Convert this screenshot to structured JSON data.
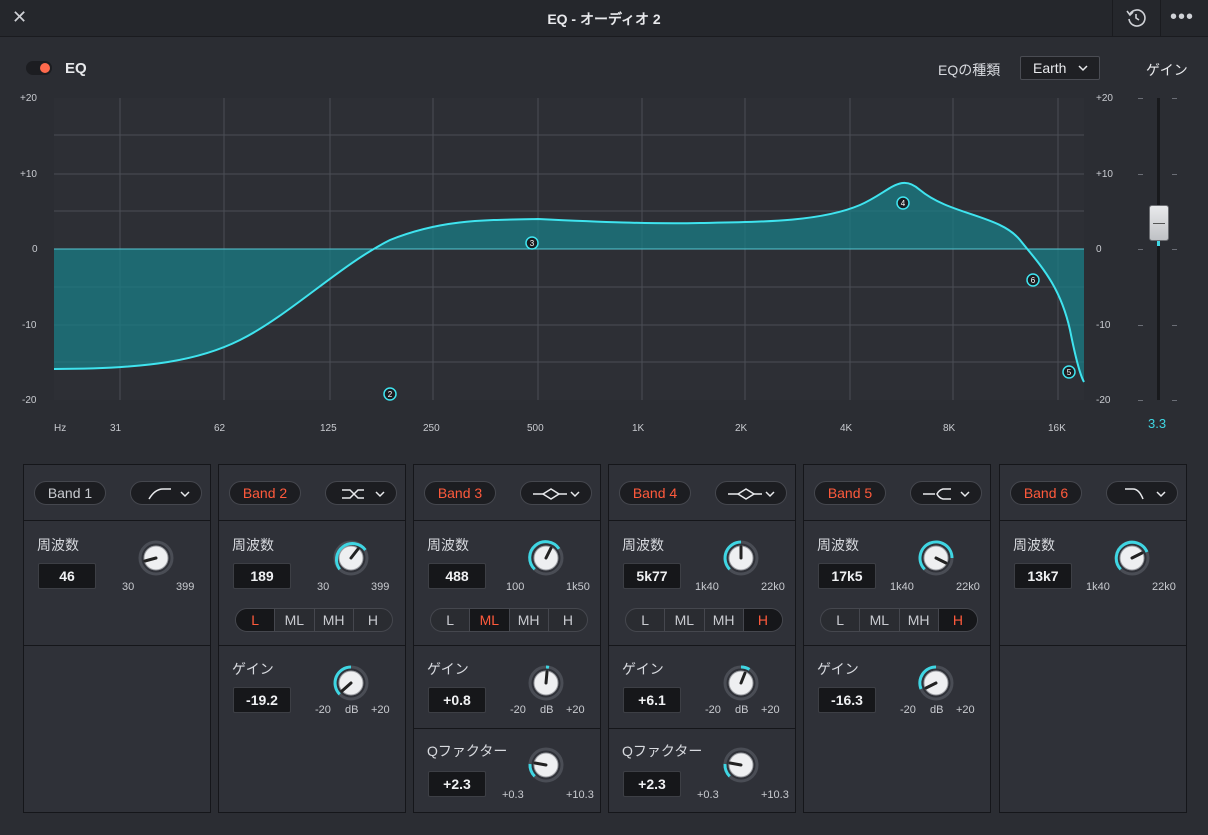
{
  "window": {
    "title": "EQ - オーディオ 2"
  },
  "eq": {
    "label": "EQ",
    "enabled": true,
    "type_label": "EQの種類",
    "type_value": "Earth"
  },
  "gain": {
    "title": "ゲイン",
    "value": "3.3"
  },
  "graph": {
    "ylabels": [
      "+20",
      "+10",
      "0",
      "-10",
      "-20"
    ],
    "xlabels": [
      "Hz",
      "31",
      "62",
      "125",
      "250",
      "500",
      "1K",
      "2K",
      "4K",
      "8K",
      "16K"
    ],
    "markers": [
      "2",
      "3",
      "4",
      "6",
      "5"
    ]
  },
  "colors": {
    "accent": "#3fd6e3",
    "active": "#ff5a3c",
    "fill": "#1a7d86"
  },
  "bands": [
    {
      "name": "Band 1",
      "active": false,
      "shape_icon": "high-pass-icon",
      "freq_label": "周波数",
      "freq_value": "46",
      "freq_min": "30",
      "freq_max": "399"
    },
    {
      "name": "Band 2",
      "active": true,
      "shape_icon": "low-shelf-icon",
      "freq_label": "周波数",
      "freq_value": "189",
      "freq_min": "30",
      "freq_max": "399",
      "ranges": [
        "L",
        "ML",
        "MH",
        "H"
      ],
      "range_selected": "L",
      "gain_label": "ゲイン",
      "gain_value": "-19.2",
      "gain_min": "-20",
      "gain_unit": "dB",
      "gain_max": "+20"
    },
    {
      "name": "Band 3",
      "active": true,
      "shape_icon": "bell-icon",
      "freq_label": "周波数",
      "freq_value": "488",
      "freq_min": "100",
      "freq_max": "1k50",
      "ranges": [
        "L",
        "ML",
        "MH",
        "H"
      ],
      "range_selected": "ML",
      "gain_label": "ゲイン",
      "gain_value": "+0.8",
      "gain_min": "-20",
      "gain_unit": "dB",
      "gain_max": "+20",
      "q_label": "Qファクター",
      "q_value": "+2.3",
      "q_min": "+0.3",
      "q_max": "+10.3"
    },
    {
      "name": "Band 4",
      "active": true,
      "shape_icon": "bell-icon",
      "freq_label": "周波数",
      "freq_value": "5k77",
      "freq_min": "1k40",
      "freq_max": "22k0",
      "ranges": [
        "L",
        "ML",
        "MH",
        "H"
      ],
      "range_selected": "H",
      "gain_label": "ゲイン",
      "gain_value": "+6.1",
      "gain_min": "-20",
      "gain_unit": "dB",
      "gain_max": "+20",
      "q_label": "Qファクター",
      "q_value": "+2.3",
      "q_min": "+0.3",
      "q_max": "+10.3"
    },
    {
      "name": "Band 5",
      "active": true,
      "shape_icon": "high-shelf-icon",
      "freq_label": "周波数",
      "freq_value": "17k5",
      "freq_min": "1k40",
      "freq_max": "22k0",
      "ranges": [
        "L",
        "ML",
        "MH",
        "H"
      ],
      "range_selected": "H",
      "gain_label": "ゲイン",
      "gain_value": "-16.3",
      "gain_min": "-20",
      "gain_unit": "dB",
      "gain_max": "+20"
    },
    {
      "name": "Band 6",
      "active": true,
      "shape_icon": "low-pass-icon",
      "freq_label": "周波数",
      "freq_value": "13k7",
      "freq_min": "1k40",
      "freq_max": "22k0"
    }
  ]
}
